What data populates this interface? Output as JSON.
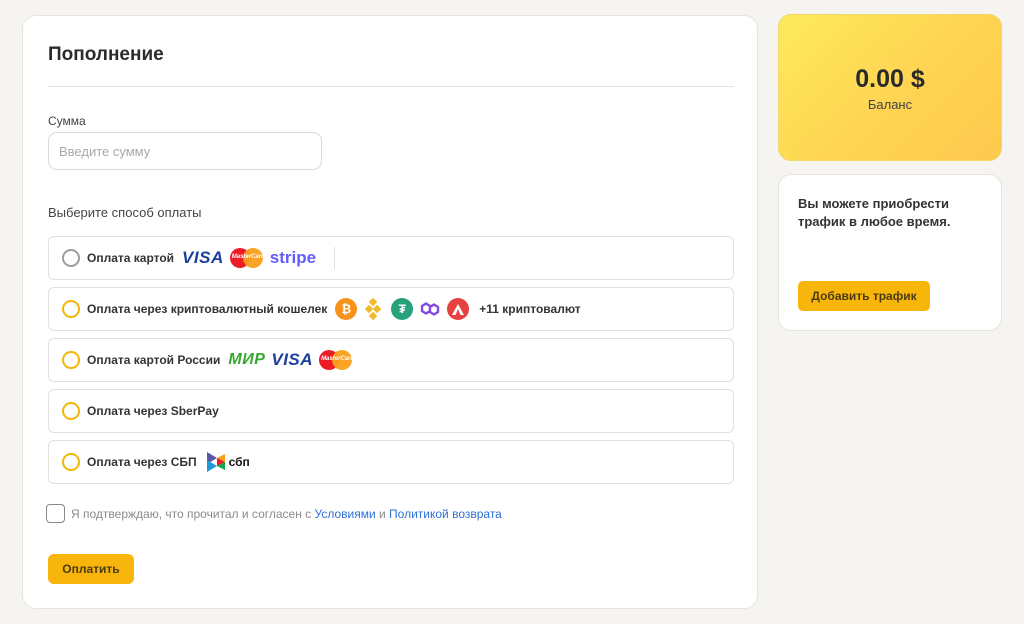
{
  "topup": {
    "title": "Пополнение",
    "amount_label": "Сумма",
    "amount_placeholder": "Введите сумму",
    "amount_value": "",
    "method_heading": "Выберите способ оплаты",
    "methods": [
      {
        "label": "Оплата картой",
        "logos": [
          "VISA",
          "MasterCard",
          "stripe"
        ]
      },
      {
        "label": "Оплата через криптовалютный кошелек",
        "icons": [
          "bitcoin-icon",
          "binance-icon",
          "tether-icon",
          "polygon-icon",
          "avalanche-icon"
        ],
        "more": "+11 криптовалют"
      },
      {
        "label": "Оплата картой России",
        "logos": [
          "МИР",
          "VISA",
          "MasterCard"
        ]
      },
      {
        "label": "Оплата через SberPay"
      },
      {
        "label": "Оплата через СБП",
        "logos": [
          "сбп"
        ]
      }
    ],
    "agree": {
      "text_before": "Я подтверждаю, что прочитал и согласен с ",
      "terms_link": "Условиями",
      "joiner": " и ",
      "refund_link": "Политикой возврата"
    },
    "pay_button": "Оплатить"
  },
  "balance": {
    "value": "0.00 $",
    "label": "Баланс"
  },
  "traffic": {
    "text": "Вы можете приобрести трафик в любое время.",
    "button": "Добавить трафик"
  },
  "colors": {
    "accent": "#f8b50b",
    "link": "#2f6fd6"
  }
}
